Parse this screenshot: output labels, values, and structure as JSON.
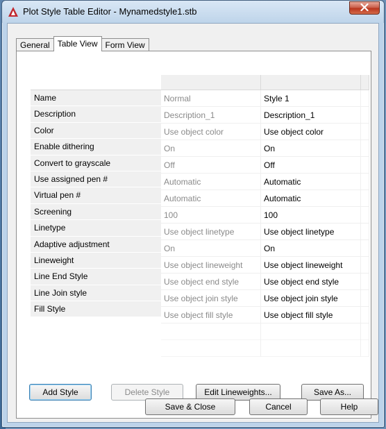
{
  "window": {
    "title": "Plot Style Table Editor - Mynamedstyle1.stb",
    "accent": "#c1272d"
  },
  "tabs": [
    {
      "label": "General",
      "active": false
    },
    {
      "label": "Table View",
      "active": true
    },
    {
      "label": "Form View",
      "active": false
    }
  ],
  "table": {
    "rows": [
      {
        "label": "Name",
        "value1": "Normal",
        "value2": "Style 1"
      },
      {
        "label": "Description",
        "value1": "Description_1",
        "value2": "Description_1"
      },
      {
        "label": "Color",
        "value1": "Use object color",
        "value2": "Use object color"
      },
      {
        "label": "Enable dithering",
        "value1": "On",
        "value2": "On"
      },
      {
        "label": "Convert to grayscale",
        "value1": "Off",
        "value2": "Off"
      },
      {
        "label": "Use assigned pen #",
        "value1": "Automatic",
        "value2": "Automatic"
      },
      {
        "label": "Virtual pen #",
        "value1": "Automatic",
        "value2": "Automatic"
      },
      {
        "label": "Screening",
        "value1": "100",
        "value2": "100"
      },
      {
        "label": "Linetype",
        "value1": "Use object linetype",
        "value2": "Use object linetype"
      },
      {
        "label": "Adaptive adjustment",
        "value1": "On",
        "value2": "On"
      },
      {
        "label": "Lineweight",
        "value1": "Use object lineweight",
        "value2": "Use object lineweight"
      },
      {
        "label": "Line End Style",
        "value1": "Use object end style",
        "value2": "Use object end style"
      },
      {
        "label": "Line Join style",
        "value1": "Use object join style",
        "value2": "Use object join style"
      },
      {
        "label": "Fill Style",
        "value1": "Use object fill style",
        "value2": "Use object fill style"
      }
    ]
  },
  "panel_buttons": {
    "add_style": "Add Style",
    "delete_style": "Delete Style",
    "edit_lineweights": "Edit Lineweights...",
    "save_as": "Save As..."
  },
  "footer_buttons": {
    "save_close": "Save & Close",
    "cancel": "Cancel",
    "help": "Help"
  }
}
